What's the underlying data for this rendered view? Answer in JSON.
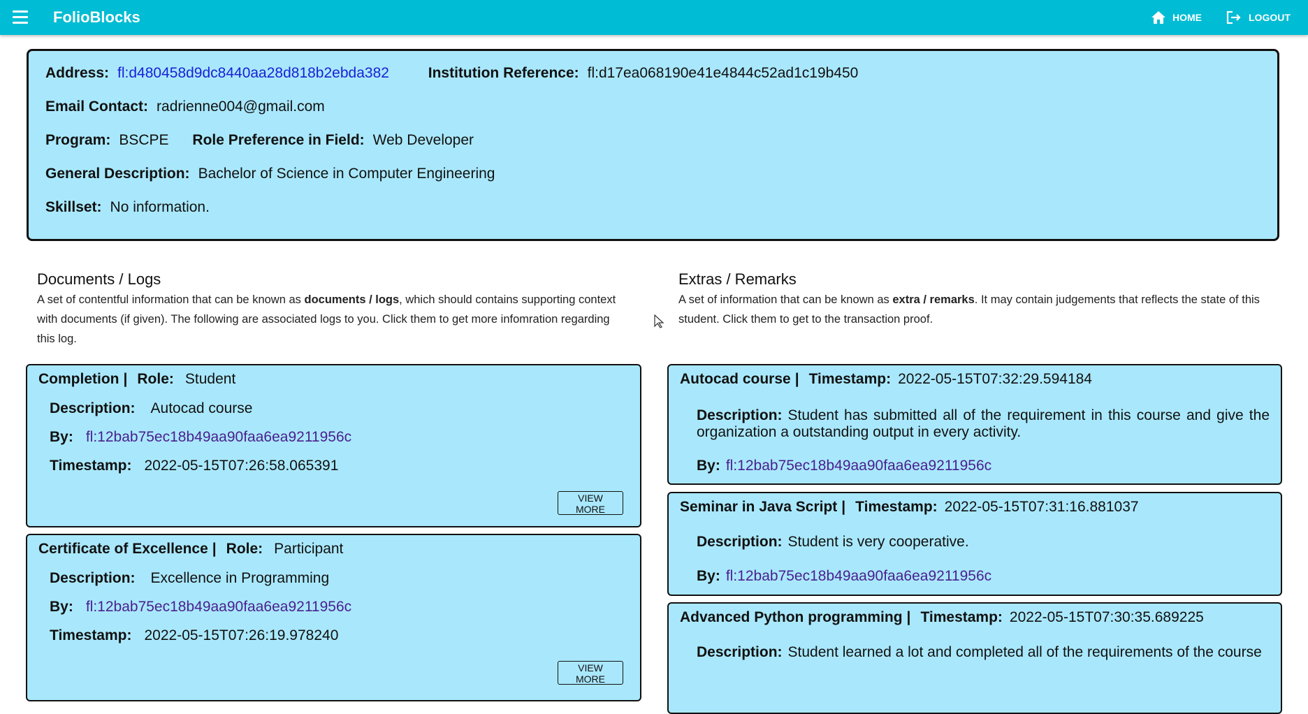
{
  "app": {
    "brand": "FolioBlocks",
    "home_label": "HOME",
    "logout_label": "LOGOUT"
  },
  "profile": {
    "address_label": "Address:",
    "address": "fl:d480458d9dc8440aa28d818b2ebda382",
    "institution_label": "Institution Reference:",
    "institution": "fl:d17ea068190e41e4844c52ad1c19b450",
    "email_label": "Email Contact:",
    "email": "radrienne004@gmail.com",
    "program_label": "Program:",
    "program": "BSCPE",
    "role_label": "Role Preference in Field:",
    "role": "Web Developer",
    "description_label": "General Description:",
    "description": "Bachelor of Science in Computer Engineering",
    "skillset_label": "Skillset:",
    "skillset": "No information."
  },
  "documents": {
    "heading": "Documents / Logs",
    "desc_pre": "A set of contentful information that can be known as ",
    "desc_bold": "documents / logs",
    "desc_post": ", which should contains supporting context with documents (if given). The following are associated logs to you. Click them to get more infomration regarding this log.",
    "items": [
      {
        "title": "Completion",
        "role_label": "Role:",
        "role": "Student",
        "desc_label": "Description:",
        "description": "Autocad course",
        "by_label": "By:",
        "by": "fl:12bab75ec18b49aa90faa6ea9211956c",
        "ts_label": "Timestamp:",
        "timestamp": "2022-05-15T07:26:58.065391",
        "button": "VIEW MORE"
      },
      {
        "title": "Certificate of Excellence",
        "role_label": "Role:",
        "role": "Participant",
        "desc_label": "Description:",
        "description": "Excellence in Programming",
        "by_label": "By:",
        "by": "fl:12bab75ec18b49aa90faa6ea9211956c",
        "ts_label": "Timestamp:",
        "timestamp": "2022-05-15T07:26:19.978240",
        "button": "VIEW MORE"
      }
    ]
  },
  "extras": {
    "heading": "Extras / Remarks",
    "desc_pre": "A set of information that can be known as ",
    "desc_bold": "extra / remarks",
    "desc_post": ". It may contain judgements that reflects the state of this student. Click them to get to the transaction proof.",
    "items": [
      {
        "title": "Autocad course",
        "ts_label": "Timestamp:",
        "timestamp": "2022-05-15T07:32:29.594184",
        "desc_label": "Description:",
        "description": "Student has submitted all of the requirement in this course and give the organization a outstanding output in every activity.",
        "by_label": "By:",
        "by": "fl:12bab75ec18b49aa90faa6ea9211956c"
      },
      {
        "title": "Seminar in Java Script",
        "ts_label": "Timestamp:",
        "timestamp": "2022-05-15T07:31:16.881037",
        "desc_label": "Description:",
        "description": "Student is very cooperative.",
        "by_label": "By:",
        "by": "fl:12bab75ec18b49aa90faa6ea9211956c"
      },
      {
        "title": "Advanced Python programming",
        "ts_label": "Timestamp:",
        "timestamp": "2022-05-15T07:30:35.689225",
        "desc_label": "Description:",
        "description": "Student learned a lot and completed all of the requirements of the course"
      }
    ]
  }
}
